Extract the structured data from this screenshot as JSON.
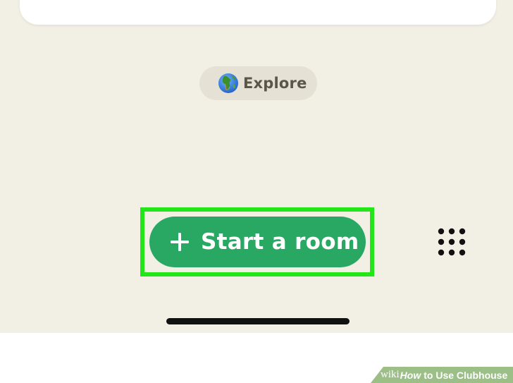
{
  "explore": {
    "label": "Explore",
    "icon": "globe-icon"
  },
  "start_room": {
    "label": "Start a room",
    "icon": "plus-icon",
    "color": "#28a862"
  },
  "grid_menu": {
    "icon": "grid-dots-icon"
  },
  "highlight": {
    "color": "#22e617"
  },
  "watermark": {
    "wiki": "wiki",
    "how": "How",
    "rest": "to Use Clubhouse"
  },
  "colors": {
    "background": "#f2efe4",
    "pill": "#e5e1d4"
  }
}
